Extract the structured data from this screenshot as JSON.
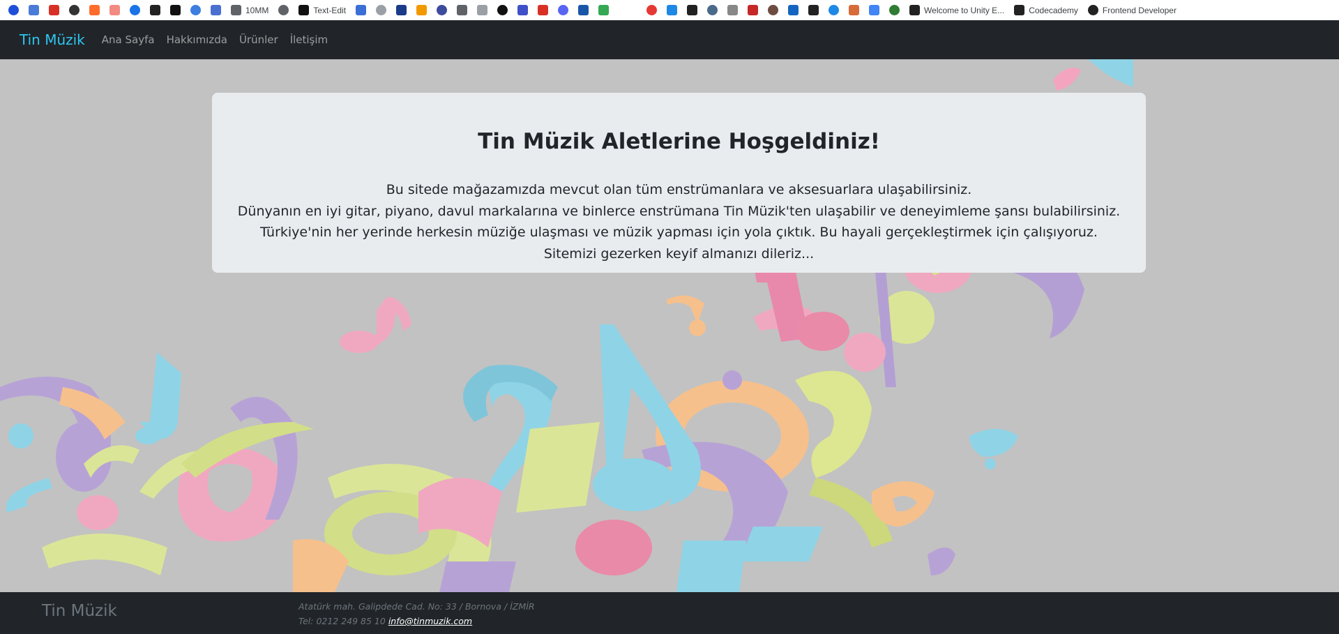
{
  "bookmarks": [
    {
      "icon": "paypal-icon",
      "color": "#1f4fd8",
      "label": ""
    },
    {
      "icon": "translate-icon",
      "color": "#4a7bd8",
      "label": ""
    },
    {
      "icon": "gmail-icon",
      "color": "#d93025",
      "label": ""
    },
    {
      "icon": "at-icon",
      "color": "#333333",
      "label": ""
    },
    {
      "icon": "cp-icon",
      "color": "#ff6c2c",
      "label": ""
    },
    {
      "icon": "mail-icon",
      "color": "#f28b82",
      "label": ""
    },
    {
      "icon": "drive-icon",
      "color": "#1a73e8",
      "label": ""
    },
    {
      "icon": "camera-icon",
      "color": "#222222",
      "label": ""
    },
    {
      "icon": "a-icon",
      "color": "#111111",
      "label": ""
    },
    {
      "icon": "dg-icon",
      "color": "#3d7ee0",
      "label": ""
    },
    {
      "icon": "star-icon",
      "color": "#4a6fd0",
      "label": ""
    },
    {
      "icon": "globe-icon",
      "color": "#5f6368",
      "label": "10MM"
    },
    {
      "icon": "film-icon",
      "color": "#5f6368",
      "label": ""
    },
    {
      "icon": "h-icon",
      "color": "#111111",
      "label": "Text-Edit"
    },
    {
      "icon": "four-icon",
      "color": "#3b6fd6",
      "label": ""
    },
    {
      "icon": "cloud-icon",
      "color": "#9aa0a6",
      "label": ""
    },
    {
      "icon": "book-icon",
      "color": "#1a3a8a",
      "label": ""
    },
    {
      "icon": "sun-icon",
      "color": "#f29900",
      "label": ""
    },
    {
      "icon": "shield-icon",
      "color": "#3c4b9c",
      "label": ""
    },
    {
      "icon": "world-icon",
      "color": "#5f6368",
      "label": ""
    },
    {
      "icon": "wave-icon",
      "color": "#9aa0a6",
      "label": ""
    },
    {
      "icon": "mic-icon",
      "color": "#111111",
      "label": ""
    },
    {
      "icon": "s-icon",
      "color": "#4050c8",
      "label": ""
    },
    {
      "icon": "heart-icon",
      "color": "#d93025",
      "label": ""
    },
    {
      "icon": "discord-icon",
      "color": "#5865f2",
      "label": ""
    },
    {
      "icon": "a2-icon",
      "color": "#1a56a8",
      "label": ""
    },
    {
      "icon": "image-icon",
      "color": "#34a853",
      "label": ""
    }
  ],
  "bookmarks_right": [
    {
      "icon": "opera-icon",
      "color": "#e53935",
      "label": ""
    },
    {
      "icon": "ring-icon",
      "color": "#1e88e5",
      "label": ""
    },
    {
      "icon": "five-icon",
      "color": "#222222",
      "label": ""
    },
    {
      "icon": "arrow-icon",
      "color": "#4a6a8a",
      "label": ""
    },
    {
      "icon": "wordpress-icon",
      "color": "#888888",
      "label": ""
    },
    {
      "icon": "wing-icon",
      "color": "#c62828",
      "label": ""
    },
    {
      "icon": "photo-icon",
      "color": "#6d4c41",
      "label": ""
    },
    {
      "icon": "c-icon",
      "color": "#1565c0",
      "label": ""
    },
    {
      "icon": "io-icon",
      "color": "#222222",
      "label": ""
    },
    {
      "icon": "triangle-icon",
      "color": "#1e88e5",
      "label": ""
    },
    {
      "icon": "gear-icon",
      "color": "#d86b3a",
      "label": ""
    },
    {
      "icon": "bars-icon",
      "color": "#4285f4",
      "label": ""
    },
    {
      "icon": "grid-icon",
      "color": "#2e7d32",
      "label": ""
    },
    {
      "icon": "unity-icon",
      "color": "#222222",
      "label": "Welcome to Unity E..."
    },
    {
      "icon": "codecademy-icon",
      "color": "#222222",
      "label": "Codecademy"
    },
    {
      "icon": "frontend-icon",
      "color": "#222222",
      "label": "Frontend Developer"
    }
  ],
  "navbar": {
    "brand": "Tin Müzik",
    "links": [
      "Ana Sayfa",
      "Hakkımızda",
      "Ürünler",
      "İletişim"
    ]
  },
  "welcome": {
    "title": "Tin Müzik Aletlerine Hoşgeldiniz!",
    "lines": [
      "Bu sitede mağazamızda mevcut olan tüm enstrümanlara ve aksesuarlara ulaşabilirsiniz.",
      "Dünyanın en iyi gitar, piyano, davul markalarına ve binlerce enstrümana Tin Müzik'ten ulaşabilir ve deneyimleme şansı bulabilirsiniz.",
      "Türkiye'nin her yerinde herkesin müziğe ulaşması ve müzik yapması için yola çıktık. Bu hayali gerçekleştirmek için çalışıyoruz.",
      "Sitemizi gezerken keyif almanızı dileriz..."
    ]
  },
  "footer": {
    "brand": "Tin Müzik",
    "address": "Atatürk mah. Galipdede Cad. No: 33 / Bornova / İZMİR",
    "phone": "Tel: 0212 249 85 10",
    "email": "info@tinmuzik.com"
  }
}
